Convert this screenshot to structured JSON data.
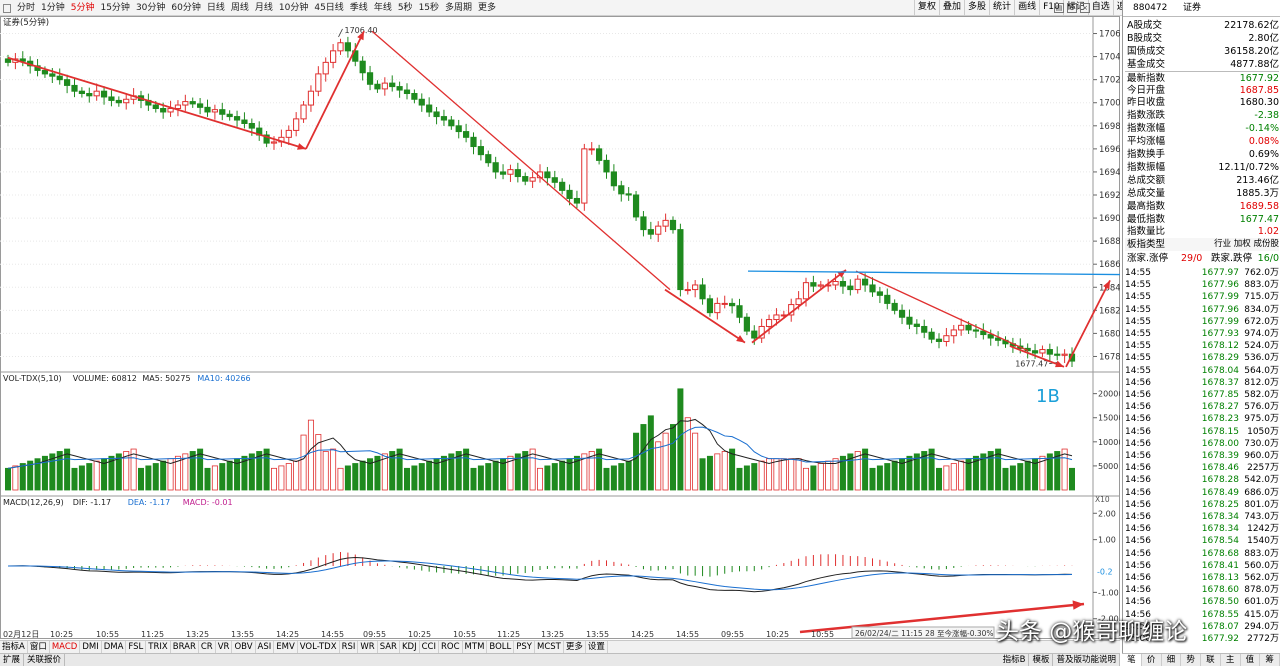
{
  "toolbar": {
    "periods": [
      "分时",
      "1分钟",
      "5分钟",
      "15分钟",
      "30分钟",
      "60分钟",
      "日线",
      "周线",
      "月线",
      "10分钟",
      "45日线",
      "季线",
      "年线",
      "5秒",
      "15秒",
      "多周期",
      "更多"
    ],
    "active_period": "5分钟",
    "right_buttons": [
      "复权",
      "叠加",
      "多股",
      "统计",
      "画线",
      "F10",
      "标记",
      "自选",
      "返回"
    ]
  },
  "chart": {
    "title": "证券(5分钟)",
    "high_label": "1706.40",
    "low_label": "1677.47",
    "price_ticks": [
      "1706",
      "1704",
      "1702",
      "1700",
      "1698",
      "1696",
      "1694",
      "1692",
      "1690",
      "1688",
      "1686",
      "1684",
      "1682",
      "1680",
      "1678"
    ],
    "volume_header": {
      "prefix": "VOL-TDX(5,10)",
      "volume": "VOLUME: 60812",
      "ma5": "MA5: 50275",
      "ma10": "MA10: 40266"
    },
    "volume_ticks": [
      "20000",
      "15000",
      "10000",
      "5000"
    ],
    "volume_unit": "X10",
    "annotation_1b": "1B",
    "macd_header": {
      "prefix": "MACD(12,26,9)",
      "dif": "DIF: -1.17",
      "dea": "DEA: -1.17",
      "macd": "MACD: -0.01"
    },
    "macd_ticks": [
      "2.00",
      "1.00",
      "-1.00",
      "-2.00"
    ],
    "macd_current": "-0.2",
    "time_axis": [
      "02月12日",
      "10:25",
      "10:55",
      "11:25",
      "13:25",
      "13:55",
      "14:25",
      "14:55",
      "09:55",
      "10:25",
      "10:55",
      "11:25",
      "13:25",
      "13:55",
      "14:25",
      "14:55",
      "09:55",
      "10:25",
      "10:55"
    ],
    "tooltip": "26/02/24/二 11:15 28 至今涨幅-0.30%",
    "watermark": "头条 @猴哥聊缠论"
  },
  "chart_data": {
    "type": "candlestick",
    "title": "证券(5分钟)",
    "ylim": [
      1677,
      1707
    ],
    "high": 1706.4,
    "low": 1677.47,
    "price_path_close": [
      1703.5,
      1703.8,
      1703.6,
      1703.2,
      1702.8,
      1702.5,
      1702.3,
      1702,
      1701.5,
      1701,
      1700.8,
      1700.6,
      1701,
      1700.5,
      1700.2,
      1700,
      1700.3,
      1700.6,
      1700.2,
      1699.8,
      1699.5,
      1699.2,
      1699.5,
      1699.8,
      1700.1,
      1699.9,
      1699.6,
      1699.2,
      1699.4,
      1699,
      1698.8,
      1698.5,
      1698.2,
      1697.8,
      1697.2,
      1696.5,
      1696.6,
      1697,
      1697.6,
      1698.6,
      1699.8,
      1701,
      1702.5,
      1703.5,
      1704.5,
      1705.2,
      1704.5,
      1703.6,
      1702.6,
      1701.6,
      1701.2,
      1701.7,
      1701.4,
      1701.1,
      1700.8,
      1700.3,
      1699.8,
      1699.2,
      1698.8,
      1698.5,
      1698,
      1697.5,
      1697,
      1696.2,
      1695.5,
      1694.8,
      1694,
      1693.8,
      1694.2,
      1693.6,
      1693.2,
      1693.5,
      1694,
      1693.5,
      1693.1,
      1692.4,
      1691.7,
      1691.3,
      1696,
      1696,
      1695,
      1694,
      1692.8,
      1692.1,
      1692,
      1690.1,
      1689,
      1688.6,
      1689.3,
      1689.8,
      1689,
      1683.8,
      1683.8,
      1684.2,
      1683,
      1681.8,
      1682.6,
      1682.6,
      1682.4,
      1681.4,
      1680.2,
      1679.6,
      1680.6,
      1681.2,
      1681.6,
      1681.6,
      1682.5,
      1683,
      1684.4,
      1684.1,
      1684.2,
      1684.2,
      1684.5,
      1684.1,
      1683.8,
      1684.7,
      1684.2,
      1683.6,
      1683.3,
      1682.6,
      1682,
      1681.4,
      1680.8,
      1680.6,
      1680.1,
      1679.5,
      1679.3,
      1679.8,
      1680.3,
      1680.7,
      1680.3,
      1680.2,
      1679.9,
      1679.6,
      1679.4,
      1679.1,
      1678.9,
      1678.7,
      1678.5,
      1678.3,
      1678.6,
      1678.2,
      1678.1,
      1678.2,
      1677.6
    ]
  },
  "sidebar": {
    "code": "880472",
    "name": "证券",
    "quote_rows": [
      {
        "label": "A股成交",
        "value": "22178.62亿",
        "color": "normal"
      },
      {
        "label": "B股成交",
        "value": "2.80亿",
        "color": "normal"
      },
      {
        "label": "国债成交",
        "value": "36158.20亿",
        "color": "normal"
      },
      {
        "label": "基金成交",
        "value": "4877.88亿",
        "color": "normal"
      },
      {
        "label": "最新指数",
        "value": "1677.92",
        "color": "grn"
      },
      {
        "label": "今日开盘",
        "value": "1687.85",
        "color": "red"
      },
      {
        "label": "昨日收盘",
        "value": "1680.30",
        "color": "normal"
      },
      {
        "label": "指数涨跌",
        "value": "-2.38",
        "color": "grn"
      },
      {
        "label": "指数涨幅",
        "value": "-0.14%",
        "color": "grn"
      },
      {
        "label": "平均涨幅",
        "value": "0.08%",
        "color": "red"
      },
      {
        "label": "指数换手",
        "value": "0.69%",
        "color": "normal"
      },
      {
        "label": "指数振幅",
        "value": "12.11/0.72%",
        "color": "normal"
      },
      {
        "label": "总成交额",
        "value": "213.46亿",
        "color": "normal"
      },
      {
        "label": "总成交量",
        "value": "1885.3万",
        "color": "normal"
      },
      {
        "label": "最高指数",
        "value": "1689.58",
        "color": "red"
      },
      {
        "label": "最低指数",
        "value": "1677.47",
        "color": "grn"
      },
      {
        "label": "指数量比",
        "value": "1.02",
        "color": "red"
      }
    ],
    "board_type_label": "板指类型",
    "board_type_value": "行业 加权 成份股",
    "updown_label1": "涨家.涨停",
    "updown_val1": "29/0",
    "updown_label2": "跌家.跌停",
    "updown_val2": "16/0",
    "ticks": [
      {
        "t": "14:55",
        "p": "1677.97",
        "q": "762.0万"
      },
      {
        "t": "14:55",
        "p": "1677.96",
        "q": "883.0万"
      },
      {
        "t": "14:55",
        "p": "1677.99",
        "q": "715.0万"
      },
      {
        "t": "14:55",
        "p": "1677.96",
        "q": "834.0万"
      },
      {
        "t": "14:55",
        "p": "1677.99",
        "q": "672.0万"
      },
      {
        "t": "14:55",
        "p": "1677.93",
        "q": "974.0万"
      },
      {
        "t": "14:55",
        "p": "1678.12",
        "q": "524.0万"
      },
      {
        "t": "14:55",
        "p": "1678.29",
        "q": "536.0万"
      },
      {
        "t": "14:55",
        "p": "1678.04",
        "q": "564.0万"
      },
      {
        "t": "14:56",
        "p": "1678.37",
        "q": "812.0万"
      },
      {
        "t": "14:56",
        "p": "1677.85",
        "q": "582.0万"
      },
      {
        "t": "14:56",
        "p": "1678.27",
        "q": "576.0万"
      },
      {
        "t": "14:56",
        "p": "1678.23",
        "q": "975.0万"
      },
      {
        "t": "14:56",
        "p": "1678.15",
        "q": "1050万"
      },
      {
        "t": "14:56",
        "p": "1678.00",
        "q": "730.0万"
      },
      {
        "t": "14:56",
        "p": "1678.39",
        "q": "960.0万"
      },
      {
        "t": "14:56",
        "p": "1678.46",
        "q": "2257万"
      },
      {
        "t": "14:56",
        "p": "1678.28",
        "q": "542.0万"
      },
      {
        "t": "14:56",
        "p": "1678.49",
        "q": "686.0万"
      },
      {
        "t": "14:56",
        "p": "1678.25",
        "q": "801.0万"
      },
      {
        "t": "14:56",
        "p": "1678.34",
        "q": "743.0万"
      },
      {
        "t": "14:56",
        "p": "1678.34",
        "q": "1242万"
      },
      {
        "t": "14:56",
        "p": "1678.54",
        "q": "1540万"
      },
      {
        "t": "14:56",
        "p": "1678.68",
        "q": "883.0万"
      },
      {
        "t": "14:56",
        "p": "1678.41",
        "q": "560.0万"
      },
      {
        "t": "14:56",
        "p": "1678.13",
        "q": "562.0万"
      },
      {
        "t": "14:56",
        "p": "1678.60",
        "q": "878.0万"
      },
      {
        "t": "14:56",
        "p": "1678.50",
        "q": "601.0万"
      },
      {
        "t": "14:56",
        "p": "1678.55",
        "q": "415.0万"
      },
      {
        "t": "14:56",
        "p": "1678.07",
        "q": "294.0万"
      },
      {
        "t": "15:00",
        "p": "1677.92",
        "q": "2772万"
      }
    ],
    "bottom_tabs": [
      "笔",
      "价",
      "细",
      "势",
      "联",
      "主",
      "值",
      "筹"
    ]
  },
  "indicator_tabs": [
    "指标A",
    "窗口",
    "MACD",
    "DMI",
    "DMA",
    "FSL",
    "TRIX",
    "BRAR",
    "CR",
    "VR",
    "OBV",
    "ASI",
    "EMV",
    "VOL-TDX",
    "RSI",
    "WR",
    "SAR",
    "KDJ",
    "CCI",
    "ROC",
    "MTM",
    "BOLL",
    "PSY",
    "MCST",
    "更多",
    "设置"
  ],
  "active_indicator": "MACD",
  "status": {
    "left1": "扩展",
    "left2": "关联报价",
    "right1": "指标B",
    "right2": "模板",
    "right3": "普及版功能说明"
  }
}
